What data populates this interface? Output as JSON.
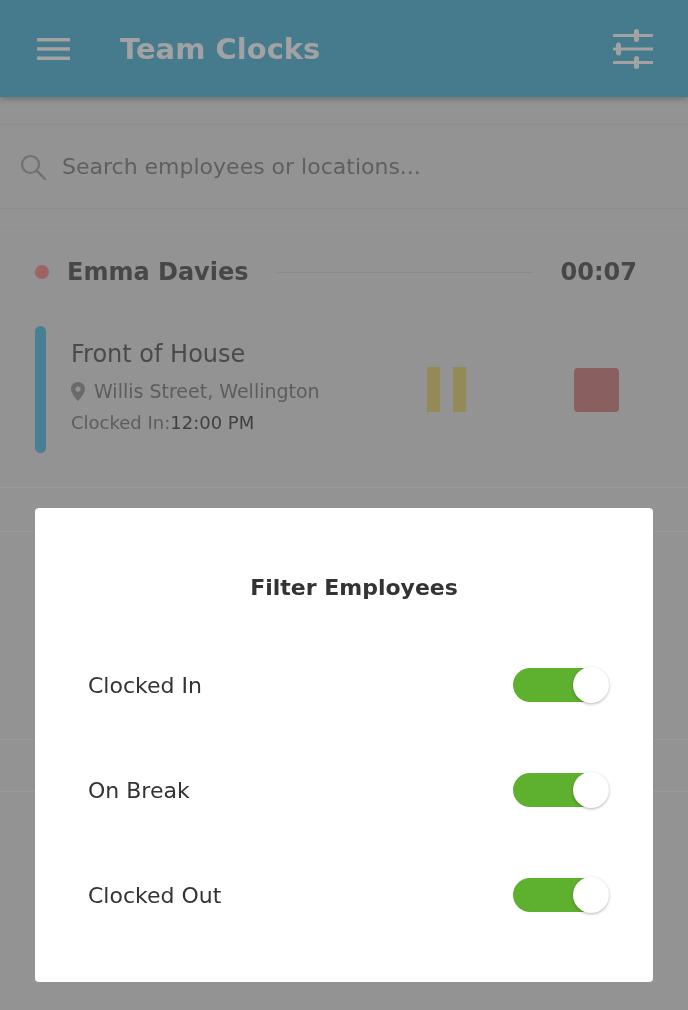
{
  "header": {
    "title": "Team Clocks"
  },
  "search": {
    "placeholder": "Search employees or locations..."
  },
  "employees": [
    {
      "name": "Emma Davies",
      "color": "#9c6464",
      "timer": "00:07",
      "shifts": [
        {
          "role": "Front of House",
          "location": "Willis Street, Wellington",
          "clocked_in_label": "Clocked In:",
          "clocked_in_time": "12:00 PM",
          "color": "#478092"
        }
      ]
    }
  ],
  "filter_dialog": {
    "title": "Filter Employees",
    "options": [
      {
        "label": "Clocked In",
        "on": true
      },
      {
        "label": "On Break",
        "on": true
      },
      {
        "label": "Clocked Out",
        "on": true
      }
    ]
  }
}
